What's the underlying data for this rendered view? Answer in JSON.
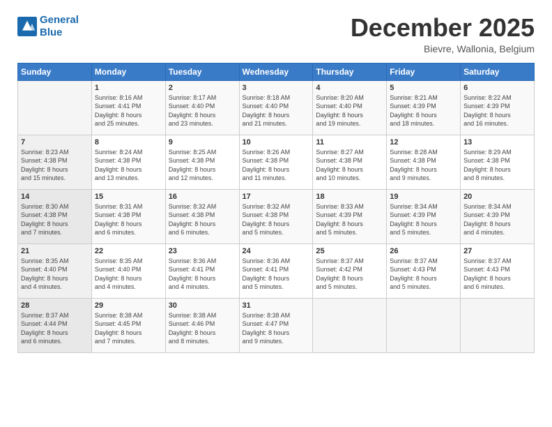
{
  "header": {
    "logo_line1": "General",
    "logo_line2": "Blue",
    "month": "December 2025",
    "location": "Bievre, Wallonia, Belgium"
  },
  "weekdays": [
    "Sunday",
    "Monday",
    "Tuesday",
    "Wednesday",
    "Thursday",
    "Friday",
    "Saturday"
  ],
  "weeks": [
    [
      {
        "num": "",
        "info": ""
      },
      {
        "num": "1",
        "info": "Sunrise: 8:16 AM\nSunset: 4:41 PM\nDaylight: 8 hours\nand 25 minutes."
      },
      {
        "num": "2",
        "info": "Sunrise: 8:17 AM\nSunset: 4:40 PM\nDaylight: 8 hours\nand 23 minutes."
      },
      {
        "num": "3",
        "info": "Sunrise: 8:18 AM\nSunset: 4:40 PM\nDaylight: 8 hours\nand 21 minutes."
      },
      {
        "num": "4",
        "info": "Sunrise: 8:20 AM\nSunset: 4:40 PM\nDaylight: 8 hours\nand 19 minutes."
      },
      {
        "num": "5",
        "info": "Sunrise: 8:21 AM\nSunset: 4:39 PM\nDaylight: 8 hours\nand 18 minutes."
      },
      {
        "num": "6",
        "info": "Sunrise: 8:22 AM\nSunset: 4:39 PM\nDaylight: 8 hours\nand 16 minutes."
      }
    ],
    [
      {
        "num": "7",
        "info": "Sunrise: 8:23 AM\nSunset: 4:38 PM\nDaylight: 8 hours\nand 15 minutes."
      },
      {
        "num": "8",
        "info": "Sunrise: 8:24 AM\nSunset: 4:38 PM\nDaylight: 8 hours\nand 13 minutes."
      },
      {
        "num": "9",
        "info": "Sunrise: 8:25 AM\nSunset: 4:38 PM\nDaylight: 8 hours\nand 12 minutes."
      },
      {
        "num": "10",
        "info": "Sunrise: 8:26 AM\nSunset: 4:38 PM\nDaylight: 8 hours\nand 11 minutes."
      },
      {
        "num": "11",
        "info": "Sunrise: 8:27 AM\nSunset: 4:38 PM\nDaylight: 8 hours\nand 10 minutes."
      },
      {
        "num": "12",
        "info": "Sunrise: 8:28 AM\nSunset: 4:38 PM\nDaylight: 8 hours\nand 9 minutes."
      },
      {
        "num": "13",
        "info": "Sunrise: 8:29 AM\nSunset: 4:38 PM\nDaylight: 8 hours\nand 8 minutes."
      }
    ],
    [
      {
        "num": "14",
        "info": "Sunrise: 8:30 AM\nSunset: 4:38 PM\nDaylight: 8 hours\nand 7 minutes."
      },
      {
        "num": "15",
        "info": "Sunrise: 8:31 AM\nSunset: 4:38 PM\nDaylight: 8 hours\nand 6 minutes."
      },
      {
        "num": "16",
        "info": "Sunrise: 8:32 AM\nSunset: 4:38 PM\nDaylight: 8 hours\nand 6 minutes."
      },
      {
        "num": "17",
        "info": "Sunrise: 8:32 AM\nSunset: 4:38 PM\nDaylight: 8 hours\nand 5 minutes."
      },
      {
        "num": "18",
        "info": "Sunrise: 8:33 AM\nSunset: 4:39 PM\nDaylight: 8 hours\nand 5 minutes."
      },
      {
        "num": "19",
        "info": "Sunrise: 8:34 AM\nSunset: 4:39 PM\nDaylight: 8 hours\nand 5 minutes."
      },
      {
        "num": "20",
        "info": "Sunrise: 8:34 AM\nSunset: 4:39 PM\nDaylight: 8 hours\nand 4 minutes."
      }
    ],
    [
      {
        "num": "21",
        "info": "Sunrise: 8:35 AM\nSunset: 4:40 PM\nDaylight: 8 hours\nand 4 minutes."
      },
      {
        "num": "22",
        "info": "Sunrise: 8:35 AM\nSunset: 4:40 PM\nDaylight: 8 hours\nand 4 minutes."
      },
      {
        "num": "23",
        "info": "Sunrise: 8:36 AM\nSunset: 4:41 PM\nDaylight: 8 hours\nand 4 minutes."
      },
      {
        "num": "24",
        "info": "Sunrise: 8:36 AM\nSunset: 4:41 PM\nDaylight: 8 hours\nand 5 minutes."
      },
      {
        "num": "25",
        "info": "Sunrise: 8:37 AM\nSunset: 4:42 PM\nDaylight: 8 hours\nand 5 minutes."
      },
      {
        "num": "26",
        "info": "Sunrise: 8:37 AM\nSunset: 4:43 PM\nDaylight: 8 hours\nand 5 minutes."
      },
      {
        "num": "27",
        "info": "Sunrise: 8:37 AM\nSunset: 4:43 PM\nDaylight: 8 hours\nand 6 minutes."
      }
    ],
    [
      {
        "num": "28",
        "info": "Sunrise: 8:37 AM\nSunset: 4:44 PM\nDaylight: 8 hours\nand 6 minutes."
      },
      {
        "num": "29",
        "info": "Sunrise: 8:38 AM\nSunset: 4:45 PM\nDaylight: 8 hours\nand 7 minutes."
      },
      {
        "num": "30",
        "info": "Sunrise: 8:38 AM\nSunset: 4:46 PM\nDaylight: 8 hours\nand 8 minutes."
      },
      {
        "num": "31",
        "info": "Sunrise: 8:38 AM\nSunset: 4:47 PM\nDaylight: 8 hours\nand 9 minutes."
      },
      {
        "num": "",
        "info": ""
      },
      {
        "num": "",
        "info": ""
      },
      {
        "num": "",
        "info": ""
      }
    ]
  ]
}
